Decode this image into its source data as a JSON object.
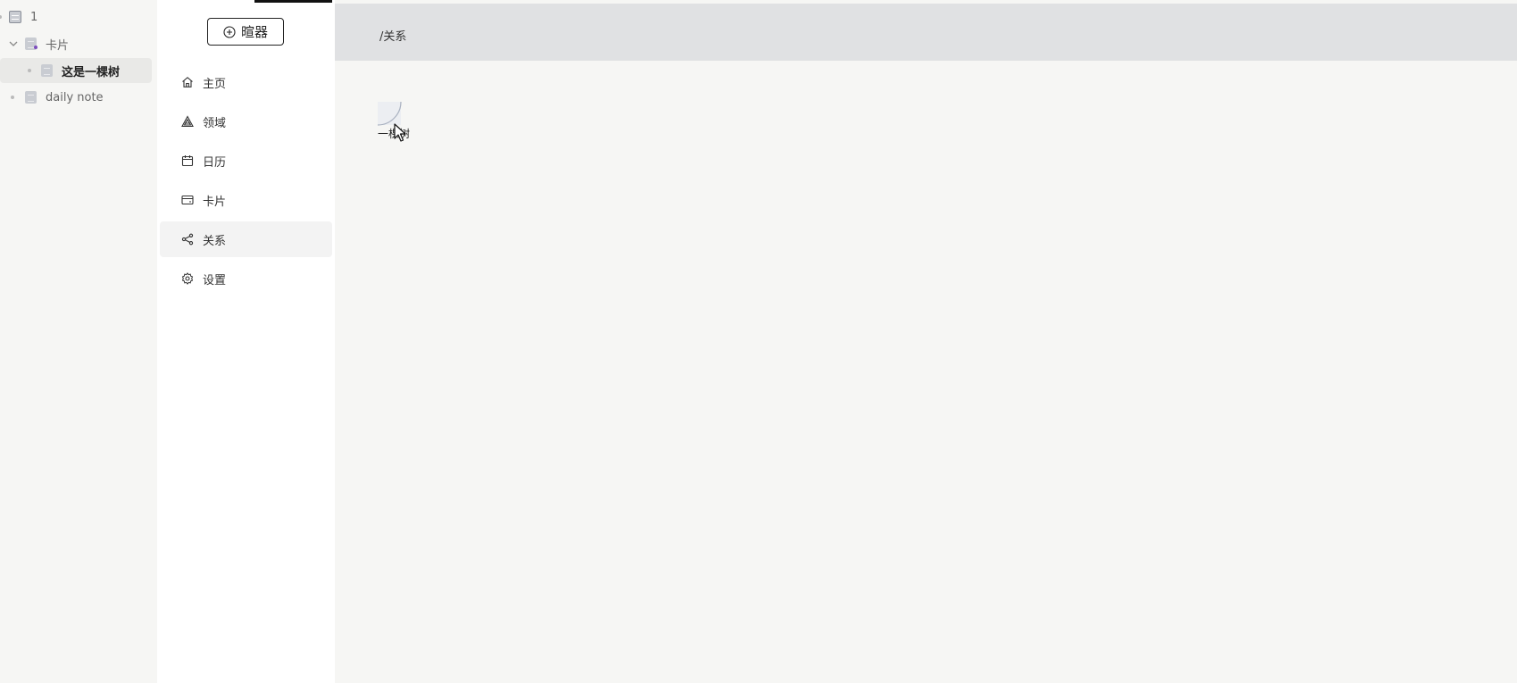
{
  "tree": {
    "root": {
      "label": "1",
      "icon": "database-icon"
    },
    "items": [
      {
        "label": "卡片",
        "icon": "document-icon",
        "expanded": true
      },
      {
        "label": "这是一棵树",
        "icon": "document-icon",
        "selected": true
      },
      {
        "label": "daily note",
        "icon": "document-icon"
      }
    ]
  },
  "sidebar": {
    "new_button": {
      "label": "暄器",
      "icon": "plus-circle-icon"
    },
    "nav": [
      {
        "label": "主页",
        "icon": "home-icon"
      },
      {
        "label": "领域",
        "icon": "triangle-layers-icon"
      },
      {
        "label": "日历",
        "icon": "calendar-icon"
      },
      {
        "label": "卡片",
        "icon": "card-icon"
      },
      {
        "label": "关系",
        "icon": "share-icon",
        "active": true
      },
      {
        "label": "设置",
        "icon": "gear-icon"
      }
    ]
  },
  "main": {
    "breadcrumb": "/关系",
    "graph": {
      "nodes": [
        {
          "label": "一棵树"
        }
      ]
    }
  },
  "colors": {
    "header_bg": "#e0e1e3",
    "page_bg": "#f6f6f4",
    "sidebar_bg": "#ffffff",
    "active_item_bg": "#f3f3f3"
  }
}
